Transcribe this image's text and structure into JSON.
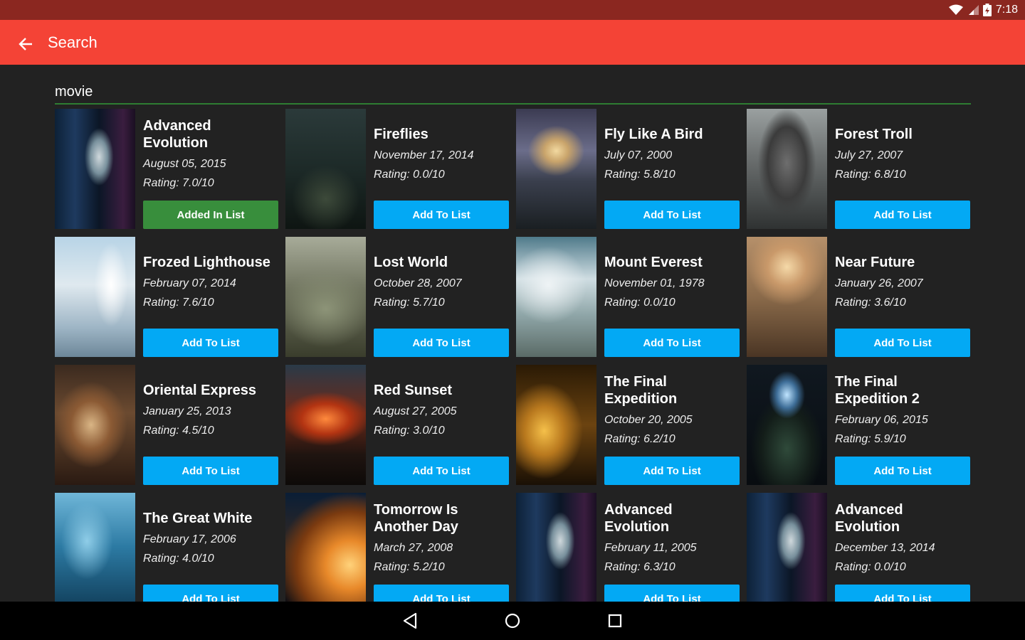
{
  "status_bar": {
    "time": "7:18",
    "icons": [
      "wifi-icon",
      "signal-icon",
      "battery-icon"
    ]
  },
  "app_bar": {
    "title": "Search",
    "back_icon": "arrow-back-icon"
  },
  "search": {
    "value": "movie"
  },
  "colors": {
    "status_bar": "#8b2720",
    "app_bar": "#f44336",
    "background": "#222222",
    "underline": "#2e7d32",
    "button_add": "#03a9f4",
    "button_added": "#388e3c"
  },
  "movies": [
    {
      "title": "Advanced Evolution",
      "date": "August 05, 2015",
      "rating_label": "Rating:",
      "rating": "7.0/10",
      "button": "Added In List",
      "added": true,
      "poster": "alien-humanoid"
    },
    {
      "title": "Fireflies",
      "date": "November 17, 2014",
      "rating_label": "Rating:",
      "rating": "0.0/10",
      "button": "Add To List",
      "added": false,
      "poster": "dark-forest"
    },
    {
      "title": "Fly Like A Bird",
      "date": "July 07, 2000",
      "rating_label": "Rating:",
      "rating": "5.8/10",
      "button": "Add To List",
      "added": false,
      "poster": "sunset-cliffs"
    },
    {
      "title": "Forest Troll",
      "date": "July 27, 2007",
      "rating_label": "Rating:",
      "rating": "6.8/10",
      "button": "Add To List",
      "added": false,
      "poster": "grey-troll"
    },
    {
      "title": "Frozed Lighthouse",
      "date": "February 07, 2014",
      "rating_label": "Rating:",
      "rating": "7.6/10",
      "button": "Add To List",
      "added": false,
      "poster": "frozen-lighthouse"
    },
    {
      "title": "Lost World",
      "date": "October 28, 2007",
      "rating_label": "Rating:",
      "rating": "5.7/10",
      "button": "Add To List",
      "added": false,
      "poster": "misty-valley"
    },
    {
      "title": "Mount Everest",
      "date": "November 01, 1978",
      "rating_label": "Rating:",
      "rating": "0.0/10",
      "button": "Add To List",
      "added": false,
      "poster": "snowy-mountain"
    },
    {
      "title": "Near Future",
      "date": "January 26, 2007",
      "rating_label": "Rating:",
      "rating": "3.6/10",
      "button": "Add To List",
      "added": false,
      "poster": "golden-hills"
    },
    {
      "title": "Oriental Express",
      "date": "January 25, 2013",
      "rating_label": "Rating:",
      "rating": "4.5/10",
      "button": "Add To List",
      "added": false,
      "poster": "train-interior"
    },
    {
      "title": "Red Sunset",
      "date": "August 27, 2005",
      "rating_label": "Rating:",
      "rating": "3.0/10",
      "button": "Add To List",
      "added": false,
      "poster": "red-sunset"
    },
    {
      "title": "The Final Expedition",
      "date": "October 20, 2005",
      "rating_label": "Rating:",
      "rating": "6.2/10",
      "button": "Add To List",
      "added": false,
      "poster": "golden-space"
    },
    {
      "title": "The Final Expedition 2",
      "date": "February 06, 2015",
      "rating_label": "Rating:",
      "rating": "5.9/10",
      "button": "Add To List",
      "added": false,
      "poster": "astronaut"
    },
    {
      "title": "The Great White",
      "date": "February 17, 2006",
      "rating_label": "Rating:",
      "rating": "4.0/10",
      "button": "Add To List",
      "added": false,
      "poster": "shark-underwater"
    },
    {
      "title": "Tomorrow Is Another Day",
      "date": "March 27, 2008",
      "rating_label": "Rating:",
      "rating": "5.2/10",
      "button": "Add To List",
      "added": false,
      "poster": "planet-glow"
    },
    {
      "title": "Advanced Evolution",
      "date": "February 11, 2005",
      "rating_label": "Rating:",
      "rating": "6.3/10",
      "button": "Add To List",
      "added": false,
      "poster": "alien-humanoid"
    },
    {
      "title": "Advanced Evolution",
      "date": "December 13, 2014",
      "rating_label": "Rating:",
      "rating": "0.0/10",
      "button": "Add To List",
      "added": false,
      "poster": "alien-humanoid"
    }
  ],
  "nav_bar": {
    "back_icon": "nav-back-icon",
    "home_icon": "nav-home-icon",
    "recents_icon": "nav-recents-icon"
  }
}
